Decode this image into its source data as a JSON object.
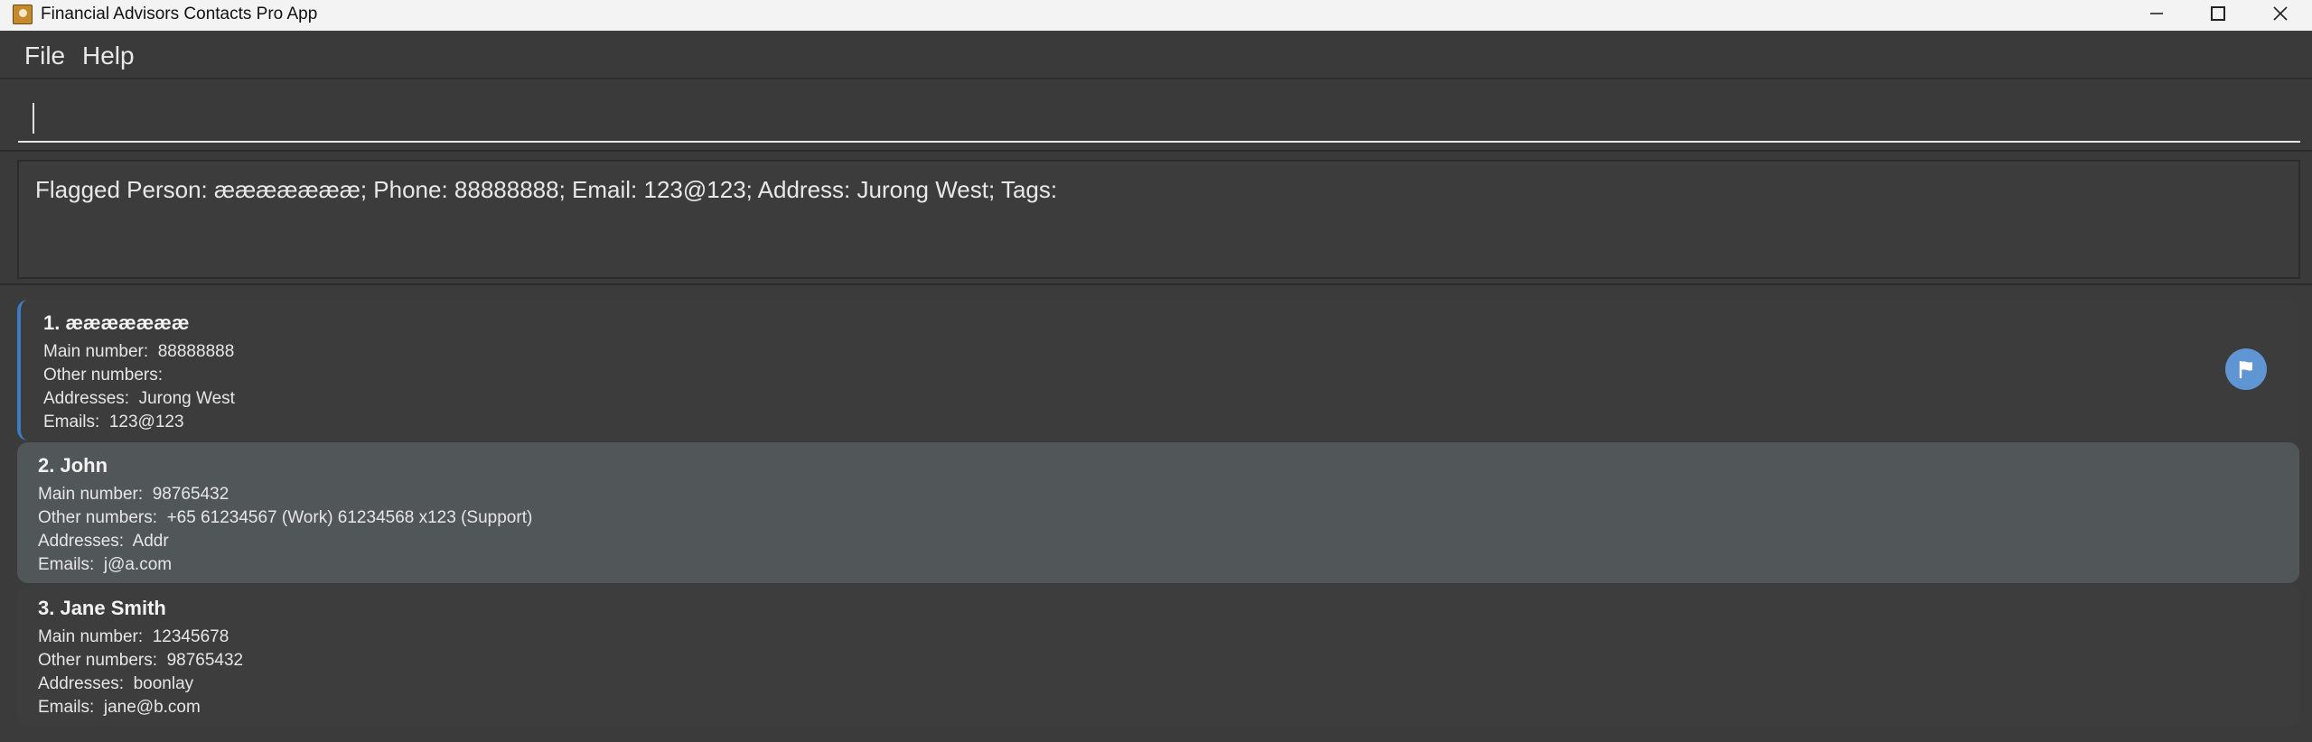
{
  "window": {
    "title": "Financial Advisors Contacts Pro App"
  },
  "menu": {
    "file": "File",
    "help": "Help"
  },
  "command": {
    "value": "",
    "placeholder": ""
  },
  "result": {
    "text": "Flagged Person: æææææææ; Phone: 88888888; Email: 123@123; Address: Jurong West; Tags:"
  },
  "labels": {
    "main_number": "Main number:",
    "other_numbers": "Other numbers:",
    "addresses": "Addresses:",
    "emails": "Emails:"
  },
  "persons": [
    {
      "index_name": "1. æææææææ",
      "main_number": "88888888",
      "other_numbers": "",
      "addresses": "Jurong West",
      "emails": "123@123",
      "flagged": true
    },
    {
      "index_name": "2. John",
      "main_number": "98765432",
      "other_numbers": "+65 61234567 (Work) 61234568 x123 (Support)",
      "addresses": "Addr",
      "emails": "j@a.com",
      "flagged": false
    },
    {
      "index_name": "3. Jane Smith",
      "main_number": "12345678",
      "other_numbers": "98765432",
      "addresses": "boonlay",
      "emails": "jane@b.com",
      "flagged": false
    }
  ],
  "colors": {
    "flag_accent": "#3e7bc0",
    "flag_icon_bg": "#5f95d2",
    "selected_card_bg": "#515659"
  },
  "icons": {
    "app": "contacts-app-icon",
    "flag": "flag-icon",
    "minimize": "minimize-icon",
    "maximize": "maximize-icon",
    "close": "close-icon"
  }
}
